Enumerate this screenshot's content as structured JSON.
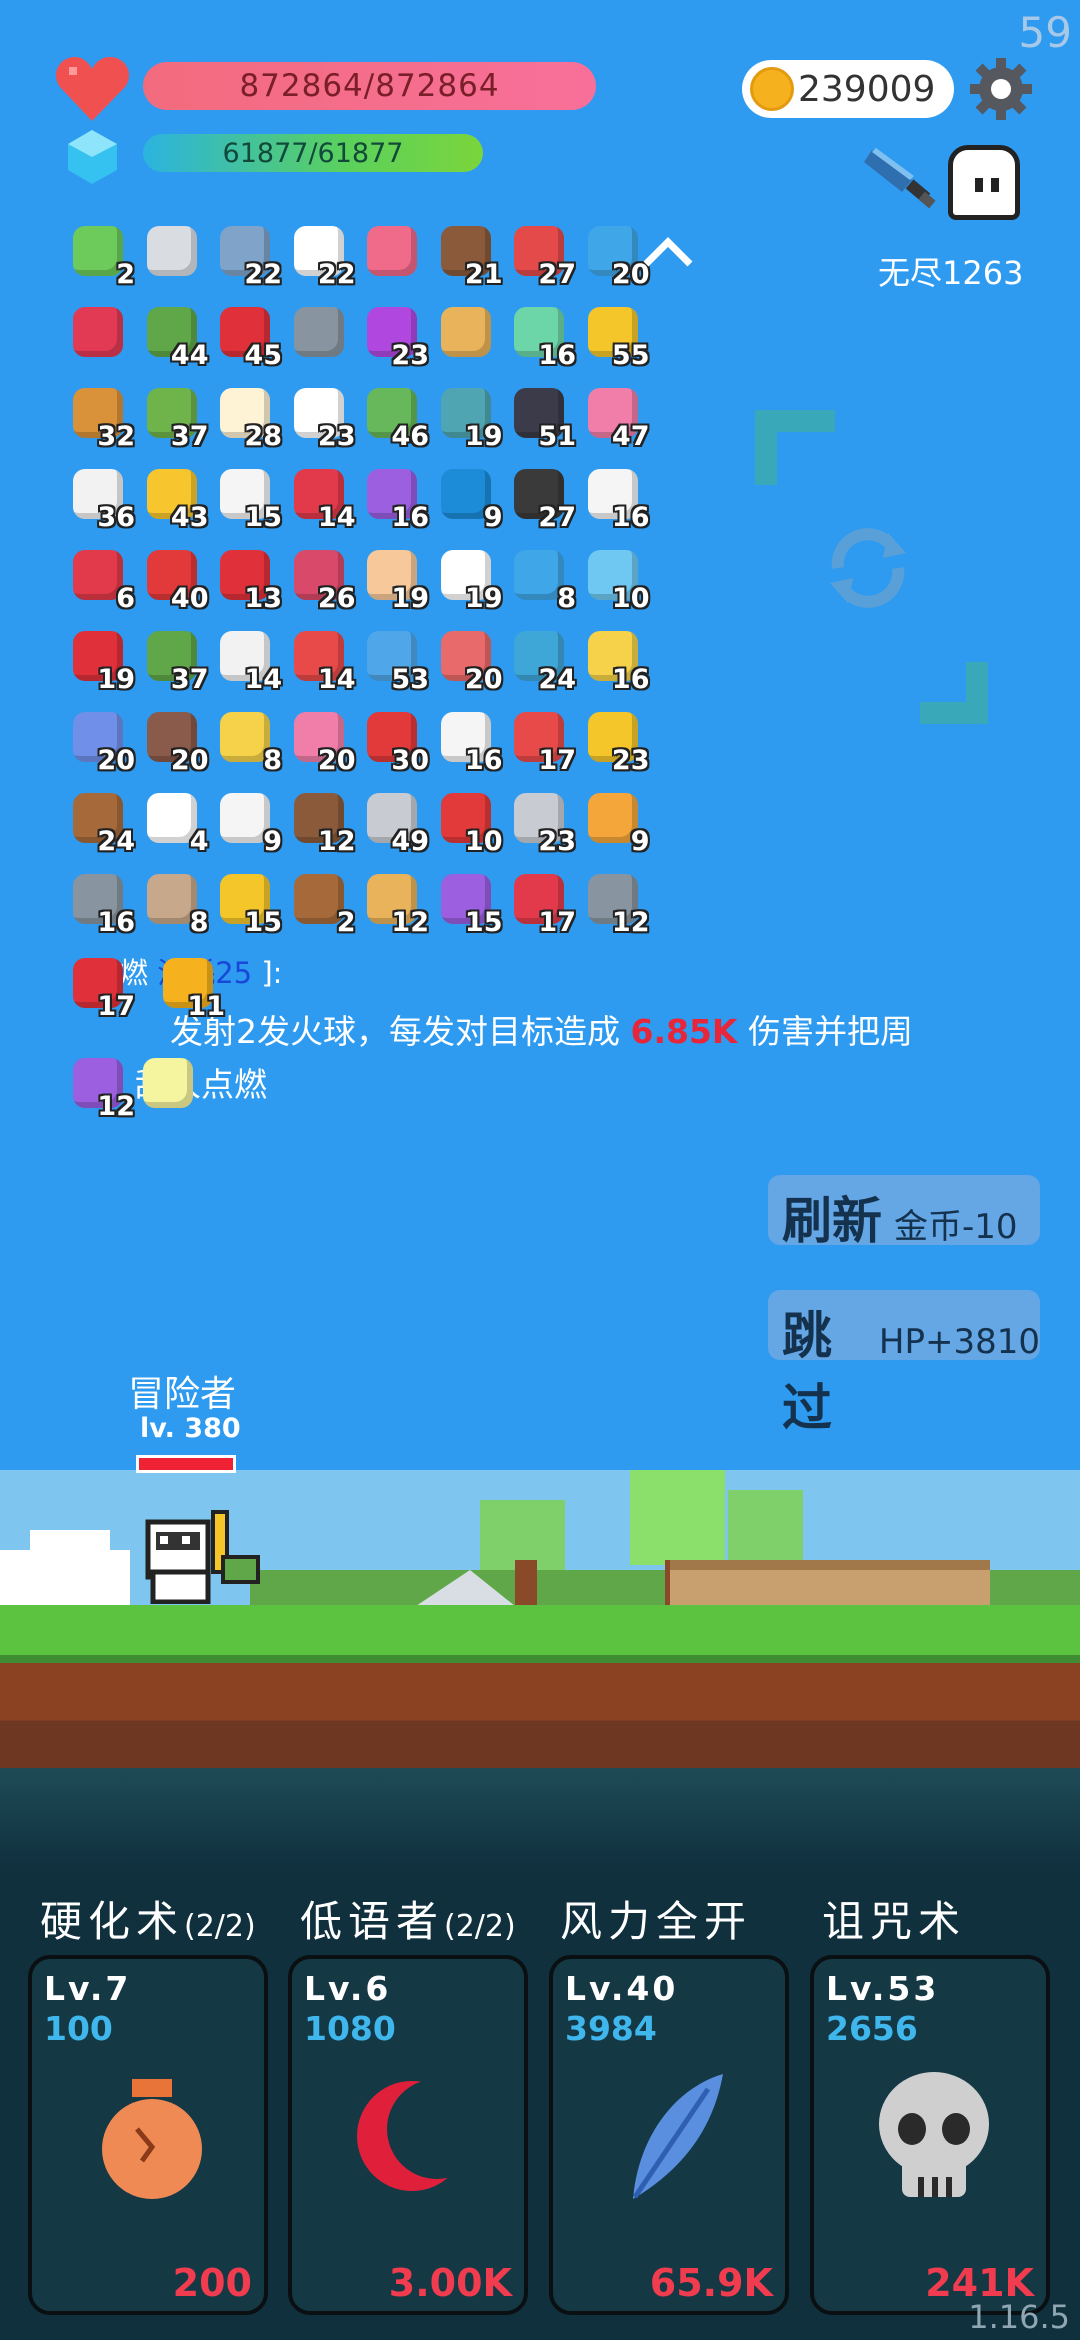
{
  "fps": "59",
  "version": "1.16.5",
  "player": {
    "hp_text": "872864/872864",
    "mp_text": "61877/61877",
    "coins": "239009",
    "stage_label": "无尽1263"
  },
  "items": [
    [
      {
        "icon": "card-icon",
        "count": "2",
        "color": "#6DCB5B"
      },
      {
        "icon": "sword-icon",
        "count": "",
        "color": "#D9DDE2"
      },
      {
        "icon": "shield-icon",
        "count": "22",
        "color": "#7FA3C9"
      },
      {
        "icon": "flower-icon",
        "count": "22",
        "color": "#FFFFFF"
      },
      {
        "icon": "love-letter-icon",
        "count": "",
        "color": "#F06A8A"
      },
      {
        "icon": "coconut-icon",
        "count": "21",
        "color": "#8A5A3A"
      },
      {
        "icon": "watermelon-icon",
        "count": "27",
        "color": "#E44A4A"
      },
      {
        "icon": "chat-bubble-icon",
        "count": "20",
        "color": "#3FA6E8"
      }
    ],
    [
      {
        "icon": "ruby-icon",
        "count": "",
        "color": "#E23A55"
      },
      {
        "icon": "green-sack-icon",
        "count": "44",
        "color": "#5FA748"
      },
      {
        "icon": "mushroom-icon",
        "count": "45",
        "color": "#E0303A"
      },
      {
        "icon": "viking-helmet-icon",
        "count": "",
        "color": "#8895A0"
      },
      {
        "icon": "crystal-ball-icon",
        "count": "23",
        "color": "#B048E0"
      },
      {
        "icon": "scroll-icon",
        "count": "",
        "color": "#E8B35A"
      },
      {
        "icon": "potion-icon",
        "count": "16",
        "color": "#6DD6A8"
      },
      {
        "icon": "crown-icon",
        "count": "55",
        "color": "#F5C62A"
      }
    ],
    [
      {
        "icon": "book-icon",
        "count": "32",
        "color": "#D9923A"
      },
      {
        "icon": "zombie-icon",
        "count": "37",
        "color": "#6FB34B"
      },
      {
        "icon": "fried-egg-icon",
        "count": "28",
        "color": "#FFF3D6"
      },
      {
        "icon": "cloud-icon",
        "count": "23",
        "color": "#FFFFFF"
      },
      {
        "icon": "cash-heart-icon",
        "count": "46",
        "color": "#66B85A"
      },
      {
        "icon": "disc-icon",
        "count": "19",
        "color": "#4FA6B2"
      },
      {
        "icon": "bat-icon",
        "count": "51",
        "color": "#3B3B4A"
      },
      {
        "icon": "ice-cream-icon",
        "count": "47",
        "color": "#F07EA8"
      }
    ],
    [
      {
        "icon": "playing-cards-icon",
        "count": "36",
        "color": "#F2F2F2"
      },
      {
        "icon": "sun-icon",
        "count": "43",
        "color": "#F7C62F"
      },
      {
        "icon": "envelope-icon",
        "count": "15",
        "color": "#F5F5F5"
      },
      {
        "icon": "gift-icon",
        "count": "14",
        "color": "#E23A4A"
      },
      {
        "icon": "purple-gift-icon",
        "count": "16",
        "color": "#9B5FE0"
      },
      {
        "icon": "blue-gem-icon",
        "count": "9",
        "color": "#1C8BD8"
      },
      {
        "icon": "bomb-icon",
        "count": "27",
        "color": "#3A3A3A"
      },
      {
        "icon": "dice-icon",
        "count": "16",
        "color": "#F5F5F5"
      }
    ],
    [
      {
        "icon": "hearts-icon",
        "count": "6",
        "color": "#E23A4A"
      },
      {
        "icon": "apple-icon",
        "count": "40",
        "color": "#E23A3A"
      },
      {
        "icon": "strawberry-icon",
        "count": "13",
        "color": "#E0303A"
      },
      {
        "icon": "jam-jar-icon",
        "count": "26",
        "color": "#D94A6A"
      },
      {
        "icon": "hand-icon",
        "count": "19",
        "color": "#F7C89A"
      },
      {
        "icon": "ghost-icon",
        "count": "19",
        "color": "#FFFFFF"
      },
      {
        "icon": "target-icon",
        "count": "8",
        "color": "#3FA6E8"
      },
      {
        "icon": "water-drop-icon",
        "count": "10",
        "color": "#6FC8F2"
      }
    ],
    [
      {
        "icon": "red-card-icon",
        "count": "19",
        "color": "#E0303A"
      },
      {
        "icon": "grenade-icon",
        "count": "37",
        "color": "#5FA748"
      },
      {
        "icon": "clipboard-icon",
        "count": "14",
        "color": "#F2F2F2"
      },
      {
        "icon": "pill-icon",
        "count": "14",
        "color": "#E84A4A"
      },
      {
        "icon": "star-card-icon",
        "count": "53",
        "color": "#4FA6E8"
      },
      {
        "icon": "meat-icon",
        "count": "20",
        "color": "#E86A6A"
      },
      {
        "icon": "blue-scroll-icon",
        "count": "24",
        "color": "#3FA6D8"
      },
      {
        "icon": "notepad-icon",
        "count": "16",
        "color": "#F5D24A"
      }
    ],
    [
      {
        "icon": "blue-pill-icon",
        "count": "20",
        "color": "#6F8FE8"
      },
      {
        "icon": "door-icon",
        "count": "20",
        "color": "#8A5A4A"
      },
      {
        "icon": "ring-icon",
        "count": "8",
        "color": "#F5D24A"
      },
      {
        "icon": "spray-bottle-icon",
        "count": "20",
        "color": "#F07EA8"
      },
      {
        "icon": "sock-icon",
        "count": "30",
        "color": "#E23A3A"
      },
      {
        "icon": "halo-icon",
        "count": "16",
        "color": "#F5F5F5"
      },
      {
        "icon": "thermometer-icon",
        "count": "17",
        "color": "#E84A4A"
      },
      {
        "icon": "sunflower-icon",
        "count": "23",
        "color": "#F5C62A"
      }
    ],
    [
      {
        "icon": "wooden-shield-icon",
        "count": "24",
        "color": "#A66A3A"
      },
      {
        "icon": "speech-dots-icon",
        "count": "4",
        "color": "#FFFFFF"
      },
      {
        "icon": "light-bulb-icon",
        "count": "9",
        "color": "#F5F5F5"
      },
      {
        "icon": "cake-icon",
        "count": "12",
        "color": "#8A5A3A"
      },
      {
        "icon": "compass-icon",
        "count": "49",
        "color": "#C8CCD2"
      },
      {
        "icon": "joystick-icon",
        "count": "10",
        "color": "#E23A3A"
      },
      {
        "icon": "short-sword-icon",
        "count": "23",
        "color": "#C8CCD2"
      },
      {
        "icon": "map-scroll-icon",
        "count": "9",
        "color": "#F5A63A"
      }
    ],
    [
      {
        "icon": "spiked-ball-icon",
        "count": "16",
        "color": "#8895A0"
      },
      {
        "icon": "noose-icon",
        "count": "8",
        "color": "#C8A88A"
      },
      {
        "icon": "magic-wand-icon",
        "count": "15",
        "color": "#F5C62A"
      },
      {
        "icon": "crossbow-icon",
        "count": "2",
        "color": "#A66A3A"
      },
      {
        "icon": "meteor-icon",
        "count": "12",
        "color": "#E8B35A"
      },
      {
        "icon": "purple-shield-icon",
        "count": "15",
        "color": "#9B5FE0"
      },
      {
        "icon": "big-heart-icon",
        "count": "17",
        "color": "#E23A4A"
      },
      {
        "icon": "elephant-icon",
        "count": "12",
        "color": "#8895A0"
      }
    ]
  ],
  "extra_items": [
    {
      "icon": "red-shield-icon",
      "count": "17",
      "color": "#E0303A"
    },
    {
      "icon": "coin-stack-icon",
      "count": "11",
      "color": "#F5B21E"
    },
    {
      "icon": "striped-box-icon",
      "count": "12",
      "color": "#9B5FE0"
    },
    {
      "icon": "lightbulb-frame-icon",
      "count": "",
      "color": "#F5F5A0"
    }
  ],
  "description": {
    "line1_prefix": "点燃",
    "line1_cost": "消耗25",
    "line1_suffix": "]:",
    "line2_a": "发射2发火球，每发对目标造成 ",
    "line2_dmg": "6.85K",
    "line2_b": " 伤害并把周",
    "line3": "敌人点燃"
  },
  "buttons": {
    "refresh_label": "刷新",
    "refresh_cost": "金币-10",
    "skip_label": "跳过",
    "skip_reward": "HP+3810"
  },
  "hero": {
    "name": "冒险者",
    "level": "lv. 380"
  },
  "skills": [
    {
      "title": "硬化术",
      "count": "(2/2)",
      "lv": "Lv.7",
      "power": "100",
      "cost": "200",
      "icon": "vase-icon"
    },
    {
      "title": "低语者",
      "count": "(2/2)",
      "lv": "Lv.6",
      "power": "1080",
      "cost": "3.00K",
      "icon": "crescent-moon-icon"
    },
    {
      "title": "风力全开",
      "count": "",
      "lv": "Lv.40",
      "power": "3984",
      "cost": "65.9K",
      "icon": "feather-icon"
    },
    {
      "title": "诅咒术",
      "count": "",
      "lv": "Lv.53",
      "power": "2656",
      "cost": "241K",
      "icon": "skull-icon"
    }
  ],
  "colors": {
    "sky": "#2E9BF0",
    "hp": "#F26B7D",
    "mp": "#5BD15B",
    "coin": "#F5B21E",
    "power": "#3FB7EC",
    "cost": "#F03C4E",
    "damage": "#E8263A"
  }
}
